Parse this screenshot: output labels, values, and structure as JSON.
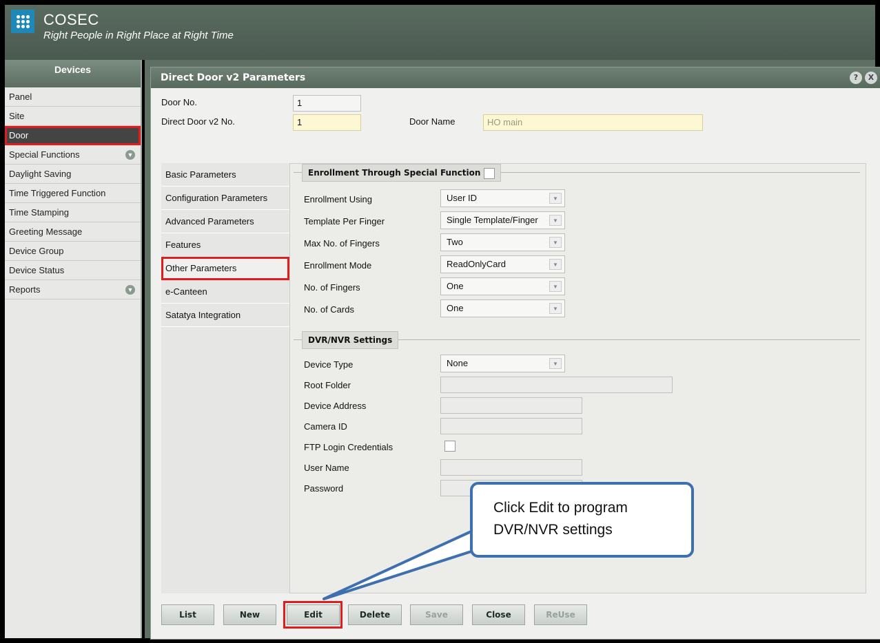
{
  "header": {
    "brand": "COSEC",
    "tagline": "Right People in Right Place at Right Time"
  },
  "sidebar": {
    "title": "Devices",
    "items": [
      {
        "label": "Panel"
      },
      {
        "label": "Site"
      },
      {
        "label": "Door"
      },
      {
        "label": "Special Functions"
      },
      {
        "label": "Daylight Saving"
      },
      {
        "label": "Time Triggered Function"
      },
      {
        "label": "Time Stamping"
      },
      {
        "label": "Greeting Message"
      },
      {
        "label": "Device Group"
      },
      {
        "label": "Device Status"
      },
      {
        "label": "Reports"
      }
    ]
  },
  "panel": {
    "title": "Direct Door v2 Parameters",
    "help_icon": "?",
    "close_icon": "X"
  },
  "form": {
    "door_no_label": "Door No.",
    "door_no_value": "1",
    "direct_door_no_label": "Direct Door v2 No.",
    "direct_door_no_value": "1",
    "door_name_label": "Door Name",
    "door_name_value": "HO main"
  },
  "tabs": [
    {
      "label": "Basic Parameters"
    },
    {
      "label": "Configuration Parameters"
    },
    {
      "label": "Advanced Parameters"
    },
    {
      "label": "Features"
    },
    {
      "label": "Other Parameters"
    },
    {
      "label": "e-Canteen"
    },
    {
      "label": "Satatya Integration"
    }
  ],
  "enrollment": {
    "section_title": "Enrollment Through Special Function",
    "fields": [
      {
        "label": "Enrollment Using",
        "value": "User ID"
      },
      {
        "label": "Template Per Finger",
        "value": "Single Template/Finger"
      },
      {
        "label": "Max No. of Fingers",
        "value": "Two"
      },
      {
        "label": "Enrollment Mode",
        "value": "ReadOnlyCard"
      },
      {
        "label": "No. of Fingers",
        "value": "One"
      },
      {
        "label": "No. of Cards",
        "value": "One"
      }
    ]
  },
  "dvr": {
    "section_title": "DVR/NVR Settings",
    "device_type_label": "Device Type",
    "device_type_value": "None",
    "root_folder_label": "Root Folder",
    "device_address_label": "Device Address",
    "camera_id_label": "Camera ID",
    "ftp_label": "FTP Login Credentials",
    "user_name_label": "User Name",
    "password_label": "Password"
  },
  "buttons": {
    "list": "List",
    "new": "New",
    "edit": "Edit",
    "delete": "Delete",
    "save": "Save",
    "close": "Close",
    "reuse": "ReUse"
  },
  "callout": {
    "text": "Click Edit to program DVR/NVR settings"
  },
  "colors": {
    "highlight_red": "#e21c1c",
    "callout_border": "#3e6fae",
    "yellow_field": "#fdf8d3"
  }
}
